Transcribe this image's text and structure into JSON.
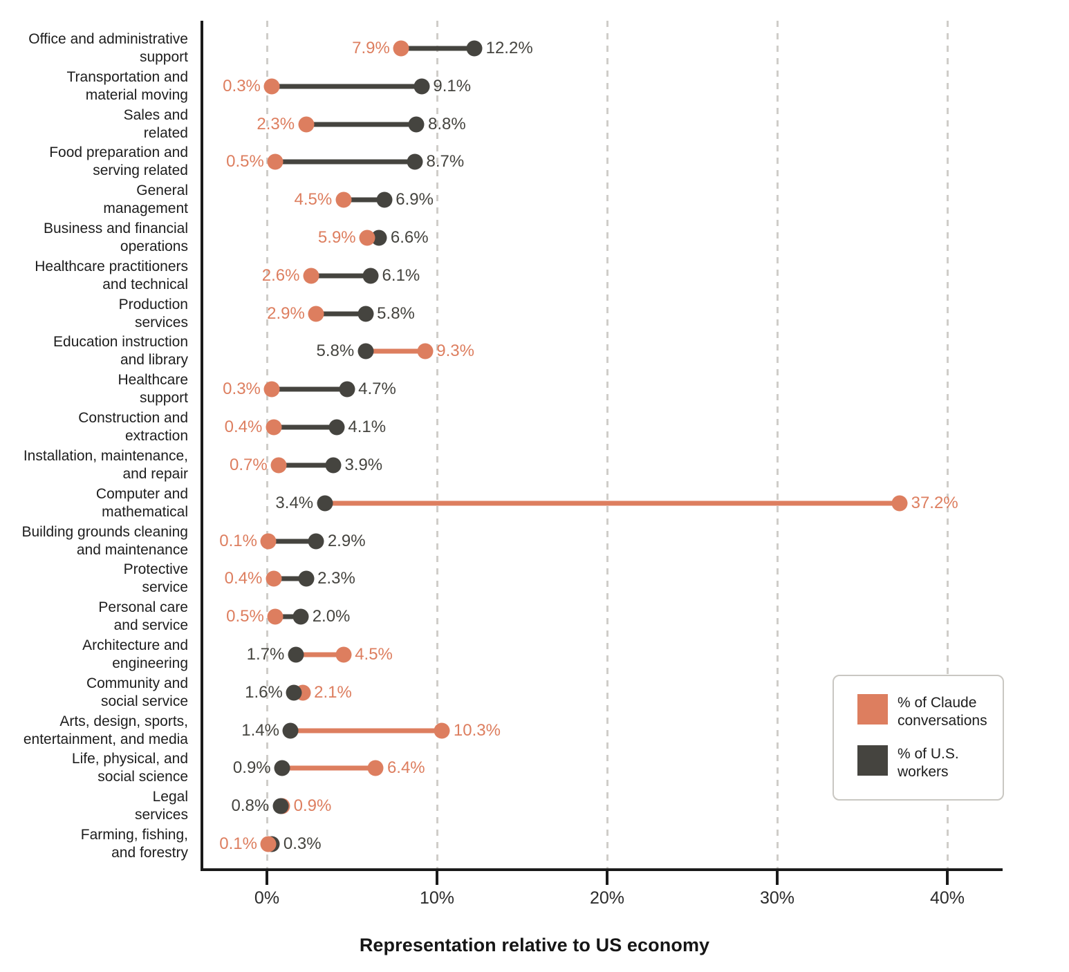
{
  "chart_data": {
    "type": "dumbbell",
    "title": "",
    "xlabel": "Representation relative to US economy",
    "ylabel": "",
    "xlim": [
      -3.5,
      43.5
    ],
    "xticks": [
      0,
      10,
      20,
      30,
      40
    ],
    "xtick_labels": [
      "0%",
      "10%",
      "20%",
      "30%",
      "40%"
    ],
    "grid": "vertical-dashed",
    "legend_position": "lower-right",
    "series": [
      {
        "name": "% of Claude conversations",
        "color": "#DD7E5F"
      },
      {
        "name": "% of U.S. workers",
        "color": "#45443F"
      }
    ],
    "categories": [
      "Office and administrative support",
      "Transportation and material moving",
      "Sales and related",
      "Food preparation and serving related",
      "General management",
      "Business and financial operations",
      "Healthcare practitioners and technical",
      "Production services",
      "Education instruction and library",
      "Healthcare support",
      "Construction and extraction",
      "Installation, maintenance, and repair",
      "Computer and mathematical",
      "Building grounds cleaning and maintenance",
      "Protective service",
      "Personal care and service",
      "Architecture and engineering",
      "Community and social service",
      "Arts, design, sports, entertainment, and media",
      "Life, physical, and social science",
      "Legal services",
      "Farming, fishing, and forestry"
    ],
    "claude_values": [
      7.9,
      0.3,
      2.3,
      0.5,
      4.5,
      5.9,
      2.6,
      2.9,
      9.3,
      0.3,
      0.4,
      0.7,
      37.2,
      0.1,
      0.4,
      0.5,
      4.5,
      2.1,
      10.3,
      6.4,
      0.9,
      0.1
    ],
    "worker_values": [
      12.2,
      9.1,
      8.8,
      8.7,
      6.9,
      6.6,
      6.1,
      5.8,
      5.8,
      4.7,
      4.1,
      3.9,
      3.4,
      2.9,
      2.3,
      2.0,
      1.7,
      1.6,
      1.4,
      0.9,
      0.8,
      0.3
    ]
  },
  "rows": [
    {
      "label_lines": [
        "Office and administrative",
        "support"
      ],
      "claude": 7.9,
      "worker": 12.2,
      "claude_label": "7.9%",
      "worker_label": "12.2%"
    },
    {
      "label_lines": [
        "Transportation and",
        "material moving"
      ],
      "claude": 0.3,
      "worker": 9.1,
      "claude_label": "0.3%",
      "worker_label": "9.1%"
    },
    {
      "label_lines": [
        "Sales and",
        "related"
      ],
      "claude": 2.3,
      "worker": 8.8,
      "claude_label": "2.3%",
      "worker_label": "8.8%"
    },
    {
      "label_lines": [
        "Food preparation and",
        "serving related"
      ],
      "claude": 0.5,
      "worker": 8.7,
      "claude_label": "0.5%",
      "worker_label": "8.7%"
    },
    {
      "label_lines": [
        "General",
        "management"
      ],
      "claude": 4.5,
      "worker": 6.9,
      "claude_label": "4.5%",
      "worker_label": "6.9%"
    },
    {
      "label_lines": [
        "Business and financial",
        "operations"
      ],
      "claude": 5.9,
      "worker": 6.6,
      "claude_label": "5.9%",
      "worker_label": "6.6%"
    },
    {
      "label_lines": [
        "Healthcare practitioners",
        "and technical"
      ],
      "claude": 2.6,
      "worker": 6.1,
      "claude_label": "2.6%",
      "worker_label": "6.1%"
    },
    {
      "label_lines": [
        "Production",
        "services"
      ],
      "claude": 2.9,
      "worker": 5.8,
      "claude_label": "2.9%",
      "worker_label": "5.8%"
    },
    {
      "label_lines": [
        "Education instruction",
        "and library"
      ],
      "claude": 9.3,
      "worker": 5.8,
      "claude_label": "9.3%",
      "worker_label": "5.8%"
    },
    {
      "label_lines": [
        "Healthcare",
        "support"
      ],
      "claude": 0.3,
      "worker": 4.7,
      "claude_label": "0.3%",
      "worker_label": "4.7%"
    },
    {
      "label_lines": [
        "Construction and",
        "extraction"
      ],
      "claude": 0.4,
      "worker": 4.1,
      "claude_label": "0.4%",
      "worker_label": "4.1%"
    },
    {
      "label_lines": [
        "Installation, maintenance,",
        "and repair"
      ],
      "claude": 0.7,
      "worker": 3.9,
      "claude_label": "0.7%",
      "worker_label": "3.9%"
    },
    {
      "label_lines": [
        "Computer and",
        "mathematical"
      ],
      "claude": 37.2,
      "worker": 3.4,
      "claude_label": "37.2%",
      "worker_label": "3.4%"
    },
    {
      "label_lines": [
        "Building grounds cleaning",
        "and maintenance"
      ],
      "claude": 0.1,
      "worker": 2.9,
      "claude_label": "0.1%",
      "worker_label": "2.9%"
    },
    {
      "label_lines": [
        "Protective",
        "service"
      ],
      "claude": 0.4,
      "worker": 2.3,
      "claude_label": "0.4%",
      "worker_label": "2.3%"
    },
    {
      "label_lines": [
        "Personal care",
        "and service"
      ],
      "claude": 0.5,
      "worker": 2.0,
      "claude_label": "0.5%",
      "worker_label": "2.0%"
    },
    {
      "label_lines": [
        "Architecture and",
        "engineering"
      ],
      "claude": 4.5,
      "worker": 1.7,
      "claude_label": "4.5%",
      "worker_label": "1.7%"
    },
    {
      "label_lines": [
        "Community and",
        "social service"
      ],
      "claude": 2.1,
      "worker": 1.6,
      "claude_label": "2.1%",
      "worker_label": "1.6%"
    },
    {
      "label_lines": [
        "Arts, design, sports,",
        "entertainment, and media"
      ],
      "claude": 10.3,
      "worker": 1.4,
      "claude_label": "10.3%",
      "worker_label": "1.4%"
    },
    {
      "label_lines": [
        "Life, physical, and",
        "social science"
      ],
      "claude": 6.4,
      "worker": 0.9,
      "claude_label": "6.4%",
      "worker_label": "0.9%"
    },
    {
      "label_lines": [
        "Legal",
        "services"
      ],
      "claude": 0.9,
      "worker": 0.8,
      "claude_label": "0.9%",
      "worker_label": "0.8%"
    },
    {
      "label_lines": [
        "Farming, fishing,",
        "and forestry"
      ],
      "claude": 0.1,
      "worker": 0.3,
      "claude_label": "0.1%",
      "worker_label": "0.3%"
    }
  ],
  "axis": {
    "title": "Representation relative to US economy",
    "ticks": [
      "0%",
      "10%",
      "20%",
      "30%",
      "40%"
    ]
  },
  "legend": {
    "items": [
      {
        "label_lines": [
          "% of Claude",
          "conversations"
        ],
        "color": "#DD7E5F"
      },
      {
        "label_lines": [
          "% of U.S.",
          "workers"
        ],
        "color": "#45443F"
      }
    ]
  },
  "colors": {
    "claude": "#DD7E5F",
    "workers": "#45443F",
    "gridline": "#cfcdc9",
    "axis": "#1a1a1a",
    "text": "#1d1d1d",
    "background": "#ffffff"
  }
}
